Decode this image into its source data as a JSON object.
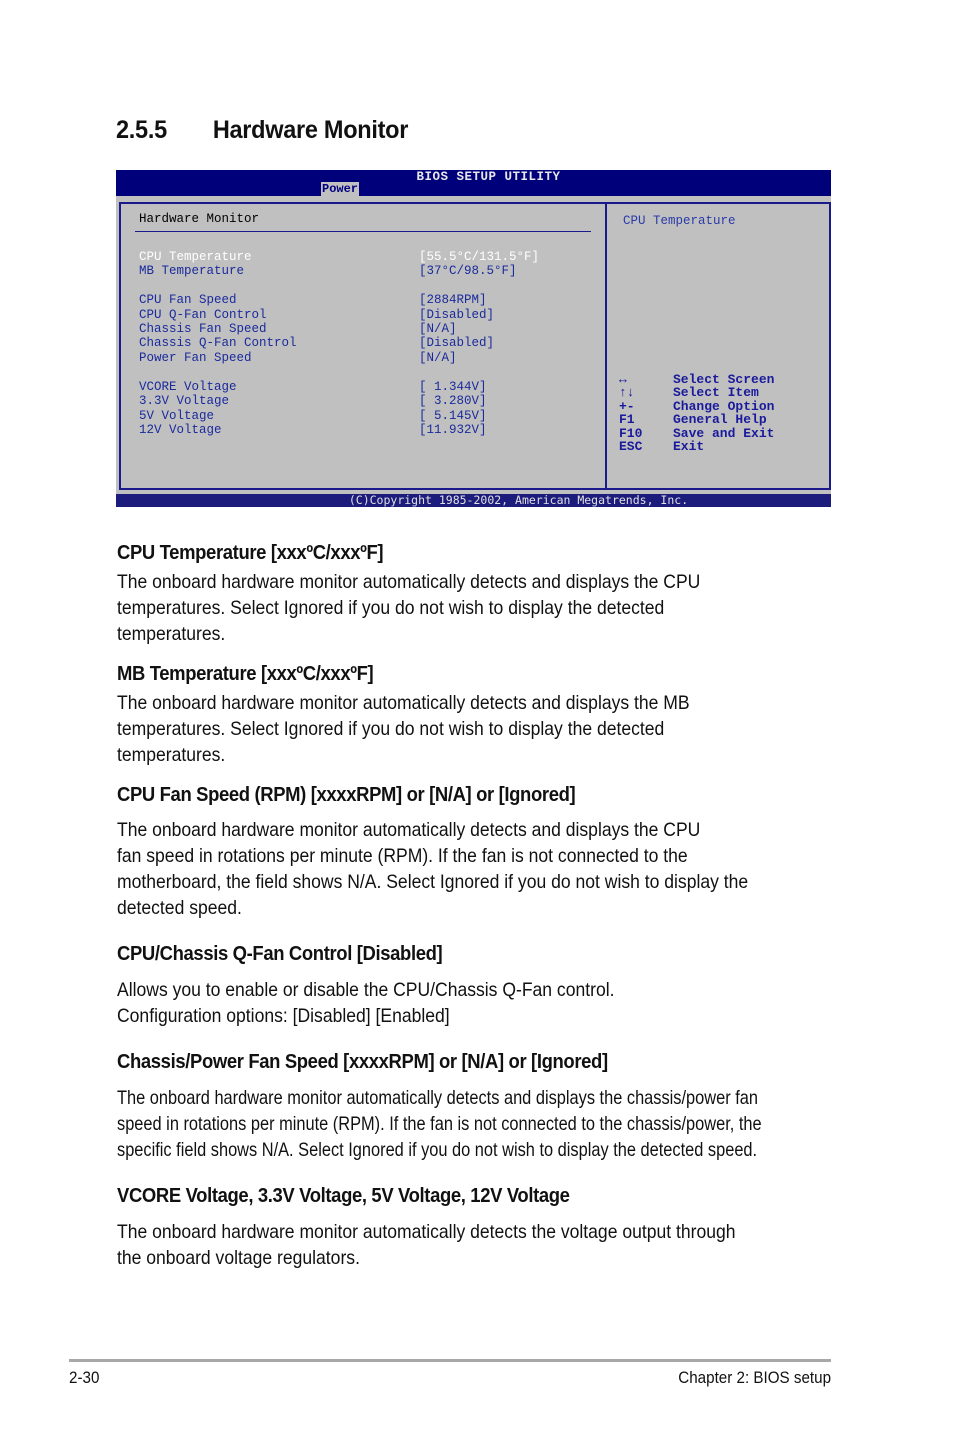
{
  "section": {
    "number": "2.5.5",
    "title": "Hardware Monitor"
  },
  "bios": {
    "title": "BIOS SETUP UTILITY",
    "active_tab": "Power",
    "panel_title": "Hardware Monitor",
    "help_title": "CPU Temperature",
    "items": [
      {
        "label": "CPU Temperature",
        "value": "[55.5°C/131.5°F]",
        "selected": true
      },
      {
        "label": "MB Temperature",
        "value": "[37°C/98.5°F]",
        "selected": false
      },
      {
        "label": "CPU Fan Speed",
        "value": "[2884RPM]",
        "selected": false
      },
      {
        "label": "CPU Q-Fan Control",
        "value": "[Disabled]",
        "selected": false
      },
      {
        "label": "Chassis Fan Speed",
        "value": "[N/A]",
        "selected": false
      },
      {
        "label": "Chassis Q-Fan Control",
        "value": "[Disabled]",
        "selected": false
      },
      {
        "label": "Power Fan Speed",
        "value": "[N/A]",
        "selected": false
      },
      {
        "label": "VCORE Voltage",
        "value": "[ 1.344V]",
        "selected": false
      },
      {
        "label": "3.3V Voltage",
        "value": "[ 3.280V]",
        "selected": false
      },
      {
        "label": "5V Voltage",
        "value": "[ 5.145V]",
        "selected": false
      },
      {
        "label": "12V Voltage",
        "value": "[11.932V]",
        "selected": false
      }
    ],
    "keys": [
      {
        "key": "↔",
        "action": "Select Screen",
        "icon": "left-right-arrow-icon"
      },
      {
        "key": "↑↓",
        "action": "Select Item",
        "icon": "up-down-arrow-icon"
      },
      {
        "key": "+-",
        "action": "Change Option",
        "icon": "plus-minus-icon"
      },
      {
        "key": "F1",
        "action": "General Help"
      },
      {
        "key": "F10",
        "action": "Save and Exit"
      },
      {
        "key": "ESC",
        "action": "Exit"
      }
    ],
    "copyright": "(C)Copyright 1985-2002, American Megatrends, Inc."
  },
  "doc": [
    {
      "heading": "CPU Temperature [xxxºC/xxxºF]",
      "lines": [
        "The onboard hardware monitor automatically detects and displays the CPU",
        "temperatures. Select Ignored if you do not wish to display the detected",
        "temperatures."
      ]
    },
    {
      "heading": "MB Temperature [xxxºC/xxxºF]",
      "lines": [
        "The onboard hardware monitor automatically detects and displays the MB",
        "temperatures. Select Ignored if you do not wish to display the detected",
        "temperatures."
      ]
    },
    {
      "heading": "CPU Fan Speed (RPM) [xxxxRPM] or [N/A] or [Ignored]",
      "lines": [
        "The onboard hardware monitor automatically detects and displays the CPU",
        "fan speed in rotations per minute (RPM). If the fan is not connected to the",
        "motherboard, the field shows N/A. Select Ignored if you do not wish to display the",
        "detected speed."
      ]
    },
    {
      "heading": "CPU/Chassis Q-Fan Control [Disabled]",
      "lines": [
        "Allows you to enable or disable the CPU/Chassis Q-Fan control.",
        "Configuration options: [Disabled] [Enabled]"
      ]
    },
    {
      "heading": "Chassis/Power Fan Speed [xxxxRPM] or [N/A] or [Ignored]",
      "lines": [
        "The onboard hardware monitor automatically detects and displays the chassis/power fan",
        "speed in rotations per minute (RPM). If the fan is not connected to the chassis/power, the",
        "specific field shows N/A. Select Ignored if you do not wish to display the detected speed."
      ]
    },
    {
      "heading": "VCORE Voltage, 3.3V Voltage, 5V Voltage, 12V Voltage",
      "lines": [
        "The onboard hardware monitor automatically detects the voltage output through",
        "the onboard voltage regulators."
      ]
    }
  ],
  "footer": {
    "page": "2-30",
    "chapter": "Chapter 2: BIOS setup"
  }
}
